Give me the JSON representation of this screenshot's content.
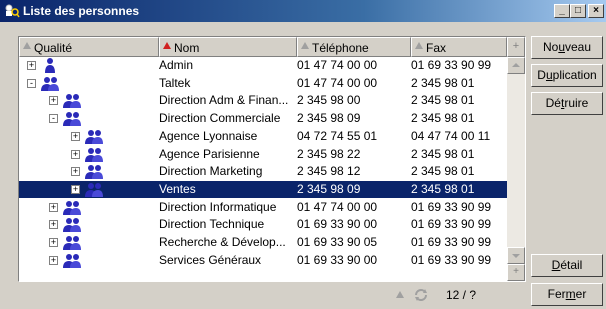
{
  "window": {
    "title": "Liste des personnes",
    "controls": {
      "minimize": "_",
      "maximize": "□",
      "close": "×"
    }
  },
  "columns": [
    {
      "label": "Qualité",
      "sorted": false
    },
    {
      "label": "Nom",
      "sorted": true
    },
    {
      "label": "Téléphone",
      "sorted": false
    },
    {
      "label": "Fax",
      "sorted": false
    }
  ],
  "header_plus": "+",
  "rows": [
    {
      "level": 0,
      "expander": "+",
      "icon": "single-person-icon",
      "nom": "Admin",
      "tel": "01 47 74 00 00",
      "fax": "01 69 33 90 99"
    },
    {
      "level": 0,
      "expander": "-",
      "icon": "group-icon",
      "nom": "Taltek",
      "tel": "01 47 74 00 00",
      "fax": "2 345 98 01"
    },
    {
      "level": 1,
      "expander": "+",
      "icon": "group-icon",
      "nom": "Direction Adm & Finan...",
      "tel": "2 345 98 00",
      "fax": "2 345 98 01"
    },
    {
      "level": 1,
      "expander": "-",
      "icon": "group-icon",
      "nom": "Direction Commerciale",
      "tel": "2 345 98 09",
      "fax": "2 345 98 01"
    },
    {
      "level": 2,
      "expander": "+",
      "icon": "group-icon",
      "nom": "Agence Lyonnaise",
      "tel": "04 72 74 55 01",
      "fax": "04 47 74 00 11"
    },
    {
      "level": 2,
      "expander": "+",
      "icon": "group-icon",
      "nom": "Agence Parisienne",
      "tel": "2 345 98 22",
      "fax": "2 345 98 01"
    },
    {
      "level": 2,
      "expander": "+",
      "icon": "group-icon",
      "nom": "Direction Marketing",
      "tel": "2 345 98 12",
      "fax": "2 345 98 01"
    },
    {
      "level": 2,
      "expander": "+",
      "icon": "group-icon",
      "nom": "Ventes",
      "tel": "2 345 98 09",
      "fax": "2 345 98 01",
      "selected": true
    },
    {
      "level": 1,
      "expander": "+",
      "icon": "group-icon",
      "nom": "Direction Informatique",
      "tel": "01 47 74 00 00",
      "fax": "01 69 33 90 99"
    },
    {
      "level": 1,
      "expander": "+",
      "icon": "group-icon",
      "nom": "Direction Technique",
      "tel": "01 69 33 90 00",
      "fax": "01 69 33 90 99"
    },
    {
      "level": 1,
      "expander": "+",
      "icon": "group-icon",
      "nom": "Recherche & Dévelop...",
      "tel": "01 69 33 90 05",
      "fax": "01 69 33 90 99"
    },
    {
      "level": 1,
      "expander": "+",
      "icon": "group-icon",
      "nom": "Services Généraux",
      "tel": "01 69 33 90 00",
      "fax": "01 69 33 90 99"
    }
  ],
  "status": {
    "counter": "12 / ?"
  },
  "buttons": {
    "nouveau": {
      "label": "Nouveau",
      "accel": "u"
    },
    "duplication": {
      "label": "Duplication",
      "accel": "u"
    },
    "detruire": {
      "label": "Détruire",
      "accel": "t"
    },
    "detail": {
      "label": "Détail",
      "accel": "D"
    },
    "fermer": {
      "label": "Fermer",
      "accel": "m"
    }
  },
  "colors": {
    "selection": "#0a246a",
    "title_start": "#0a246a",
    "title_end": "#a6caf0",
    "face": "#d4d0c8",
    "icon_blue": "#2a2ab8"
  }
}
